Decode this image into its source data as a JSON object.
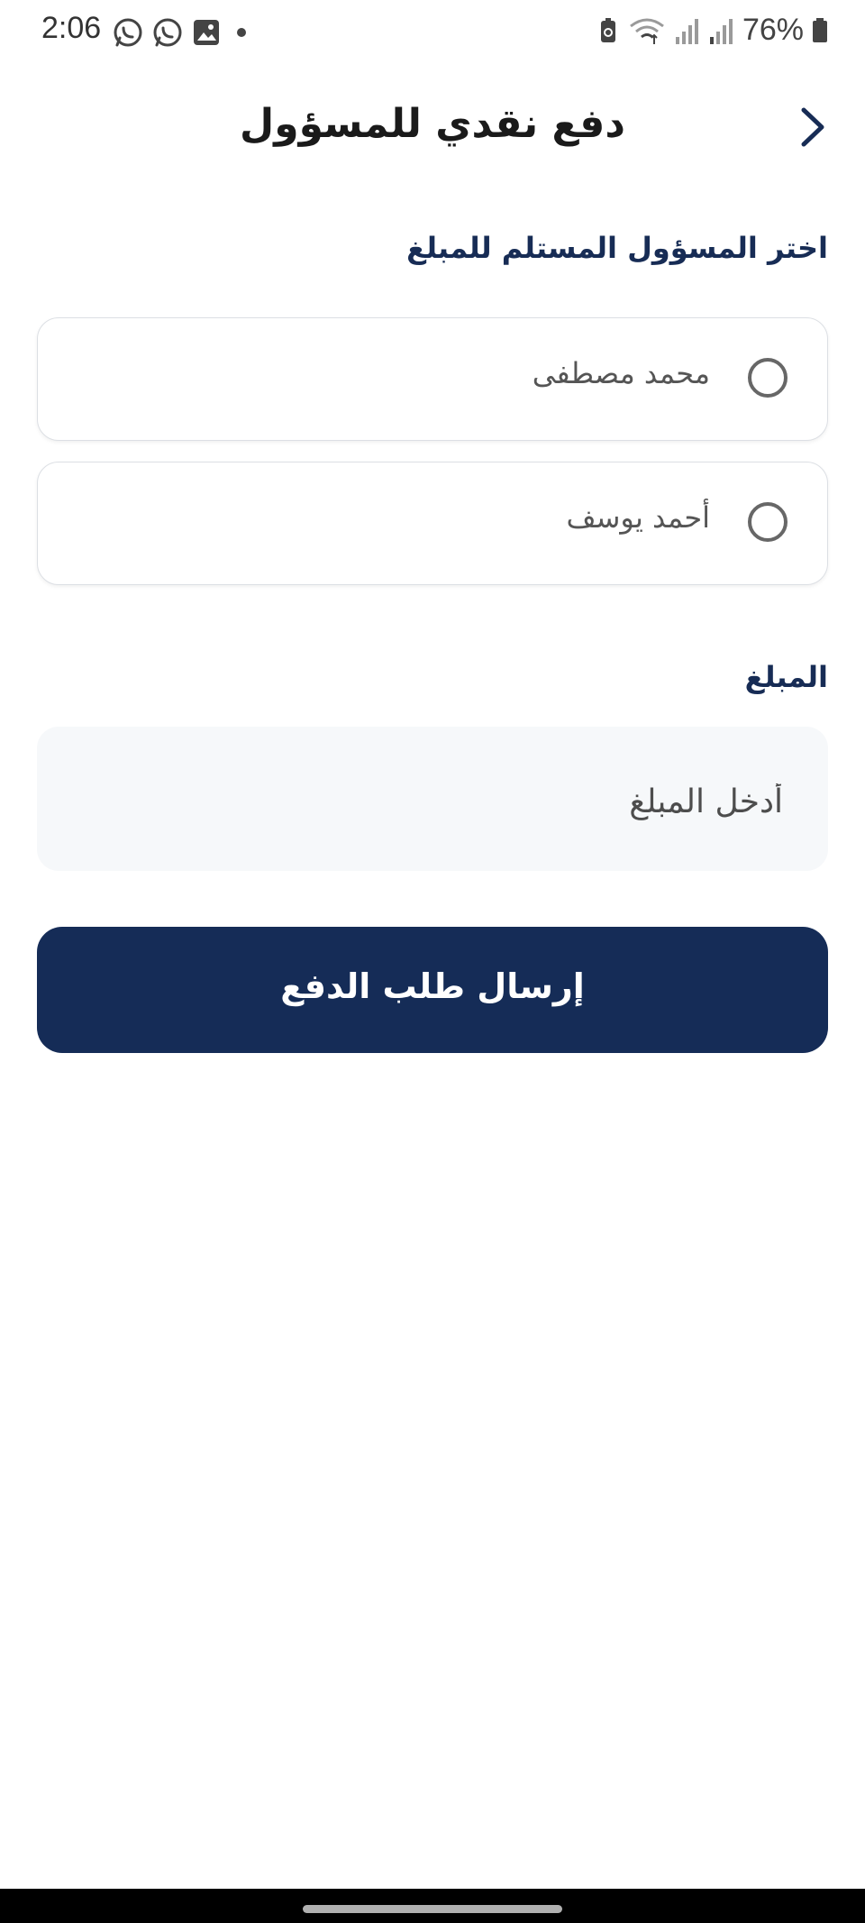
{
  "status_bar": {
    "time": "2:06",
    "battery": "76%",
    "icons_left": [
      "whatsapp-icon",
      "whatsapp-icon",
      "gallery-icon",
      "dot-icon"
    ],
    "icons_right": [
      "battery-saver-icon",
      "wifi-icon",
      "signal-icon",
      "signal-icon",
      "battery-icon"
    ]
  },
  "header": {
    "title": "دفع نقدي للمسؤول",
    "back_icon": "chevron-right-icon"
  },
  "recipient_section": {
    "label": "اختر المسؤول المستلم للمبلغ",
    "options": [
      {
        "label": "محمد مصطفى",
        "selected": false
      },
      {
        "label": "أحمد يوسف",
        "selected": false
      }
    ]
  },
  "amount_section": {
    "label": "المبلغ",
    "value": "",
    "placeholder": "أدخل المبلغ"
  },
  "submit_button": {
    "label": "إرسال طلب الدفع"
  },
  "colors": {
    "primary": "#152c57",
    "label_text": "#172c55",
    "input_bg": "#f6f8fa",
    "card_border": "#dcdfe4"
  }
}
